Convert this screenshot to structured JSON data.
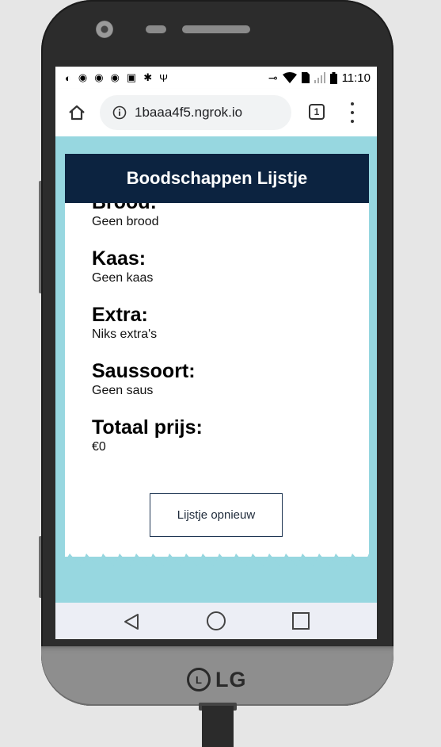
{
  "device": {
    "brand_logo": "LG",
    "brand_logo_mark": "L"
  },
  "status_bar": {
    "time": "11:10",
    "left_icons": [
      "notification-icon",
      "app-icon",
      "app-icon",
      "app-icon",
      "app-icon",
      "app-icon",
      "usb-icon"
    ],
    "right_icons": [
      "vpn-key-icon",
      "wifi-icon",
      "sim-icon",
      "signal-icon",
      "battery-icon"
    ]
  },
  "browser": {
    "url": "1baaa4f5.ngrok.io",
    "tab_count": "1"
  },
  "app": {
    "title": "Boodschappen Lijstje",
    "items": [
      {
        "label": "Brood:",
        "value": "Geen brood"
      },
      {
        "label": "Kaas:",
        "value": "Geen kaas"
      },
      {
        "label": "Extra:",
        "value": "Niks extra's"
      },
      {
        "label": "Saussoort:",
        "value": "Geen saus"
      },
      {
        "label": "Totaal prijs:",
        "value": "€0"
      }
    ],
    "reset_button": "Lijstje opnieuw"
  },
  "colors": {
    "header_bg": "#0c2340",
    "page_bg": "#97d7e0",
    "nav_bar_bg": "#eceef5"
  }
}
